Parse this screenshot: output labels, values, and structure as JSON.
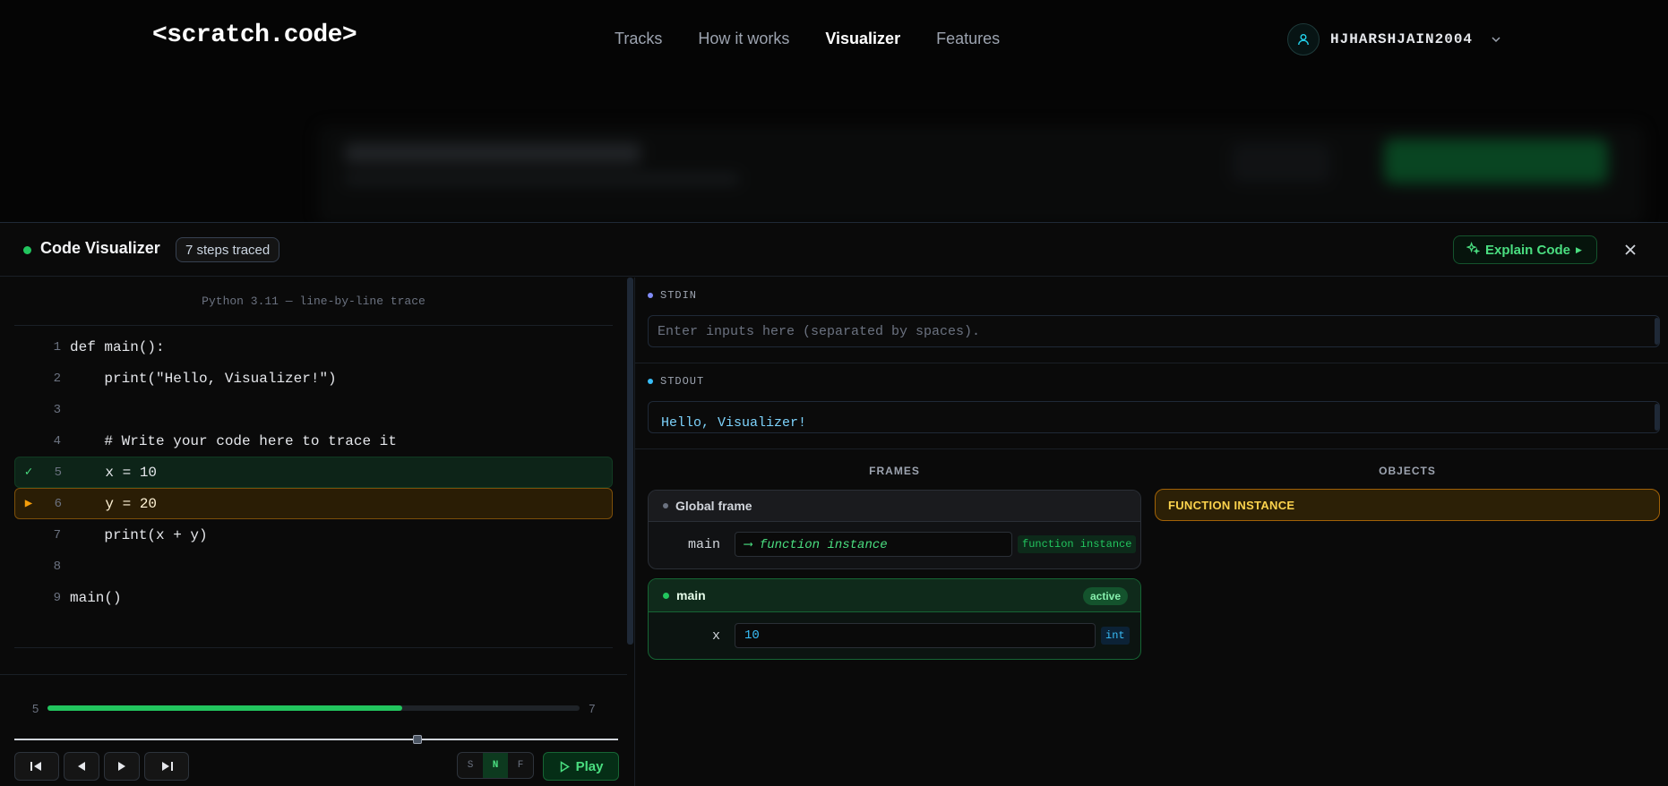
{
  "nav": {
    "logo": "<scratch.code>",
    "links": [
      "Tracks",
      "How it works",
      "Visualizer",
      "Features"
    ],
    "active": "Visualizer",
    "username": "HJHARSHJAIN2004"
  },
  "panel": {
    "title": "Code Visualizer",
    "badge": "7 steps traced",
    "explain_label": "Explain Code"
  },
  "code": {
    "header": "Python 3.11 — line-by-line trace",
    "lines": [
      {
        "n": "1",
        "text": "def main():",
        "state": "",
        "marker": ""
      },
      {
        "n": "2",
        "text": "    print(\"Hello, Visualizer!\")",
        "state": "",
        "marker": ""
      },
      {
        "n": "3",
        "text": "",
        "state": "",
        "marker": ""
      },
      {
        "n": "4",
        "text": "    # Write your code here to trace it",
        "state": "",
        "marker": ""
      },
      {
        "n": "5",
        "text": "    x = 10",
        "state": "done",
        "marker": "✓"
      },
      {
        "n": "6",
        "text": "    y = 20",
        "state": "current",
        "marker": "▶"
      },
      {
        "n": "7",
        "text": "    print(x + y)",
        "state": "",
        "marker": ""
      },
      {
        "n": "8",
        "text": "",
        "state": "",
        "marker": ""
      },
      {
        "n": "9",
        "text": "main()",
        "state": "",
        "marker": ""
      }
    ]
  },
  "progress": {
    "current": "5",
    "total": "7",
    "fraction": 0.667,
    "scrubber_fraction": 0.667
  },
  "controls": {
    "speeds": [
      "S",
      "N",
      "F"
    ],
    "active_speed": "N",
    "play_label": "Play"
  },
  "io": {
    "stdin_label": "STDIN",
    "stdin_placeholder": "Enter inputs here (separated by spaces).",
    "stdout_label": "STDOUT",
    "stdout_text": "Hello, Visualizer!"
  },
  "frames": {
    "heading": "FRAMES",
    "global": {
      "title": "Global frame",
      "var_name": "main",
      "var_value": "⟶ function instance",
      "var_type": "function instance"
    },
    "main": {
      "title": "main",
      "status": "active",
      "var_name": "x",
      "var_value": "10",
      "var_type": "int"
    }
  },
  "objects": {
    "heading": "OBJECTS",
    "items": [
      "FUNCTION INSTANCE"
    ]
  },
  "colors": {
    "accent_green": "#22c55e",
    "current_line": "#f59e0b",
    "object_gold": "#fcd34d",
    "stdout_text": "#7dd3fc"
  }
}
